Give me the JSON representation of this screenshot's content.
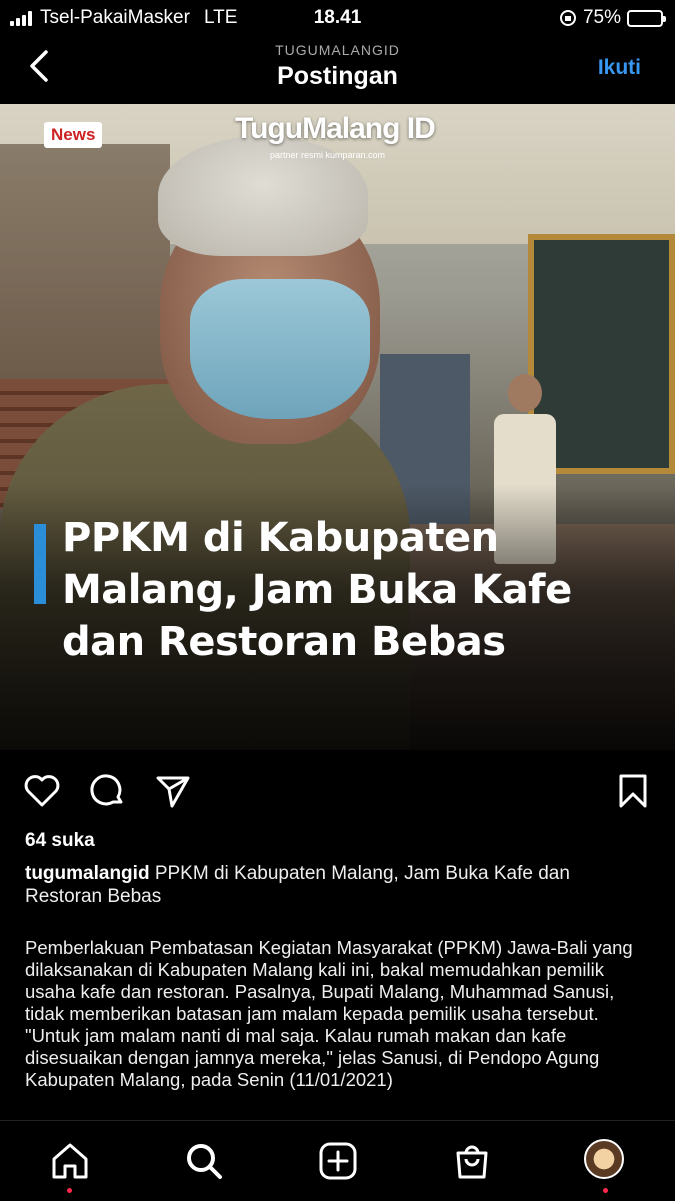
{
  "status_bar": {
    "carrier": "Tsel-PakaiMasker",
    "network": "LTE",
    "time": "18.41",
    "battery": "75%",
    "battery_level": 0.75
  },
  "header": {
    "username": "TUGUMALANGID",
    "title": "Postingan",
    "follow_label": "Ikuti"
  },
  "post_image": {
    "news_badge": "News",
    "brand": "TuguMalang ID",
    "brand_sub": "partner resmi kumparan.com",
    "headline": "PPKM di Kabupaten Malang, Jam Buka Kafe dan Restoran Bebas"
  },
  "post": {
    "likes": "64 suka",
    "caption_user": "tugumalangid",
    "caption_text": " PPKM di Kabupaten Malang, Jam Buka Kafe dan Restoran Bebas",
    "paragraph1": "Pemberlakuan Pembatasan Kegiatan Masyarakat (PPKM) Jawa-Bali yang dilaksanakan di Kabupaten Malang kali ini, bakal memudahkan pemilik usaha kafe dan restoran. Pasalnya, Bupati Malang, Muhammad Sanusi, tidak memberikan batasan jam malam kepada pemilik usaha tersebut.",
    "paragraph2": "\"Untuk jam malam nanti di mal saja. Kalau rumah makan dan kafe disesuaikan dengan jamnya mereka,\" jelas Sanusi, di Pendopo Agung Kabupaten Malang, pada Senin (11/01/2021)"
  },
  "icons": {
    "back": "chevron-left-icon",
    "like": "heart-icon",
    "comment": "comment-icon",
    "share": "send-icon",
    "save": "bookmark-icon",
    "nav": [
      "home-icon",
      "search-icon",
      "add-post-icon",
      "shop-icon",
      "profile-avatar"
    ]
  },
  "colors": {
    "follow": "#3897f0",
    "headline_bar": "#2a8fd8",
    "notification_dot": "#ff2a4d",
    "battery_fill": "#3ad13a"
  }
}
